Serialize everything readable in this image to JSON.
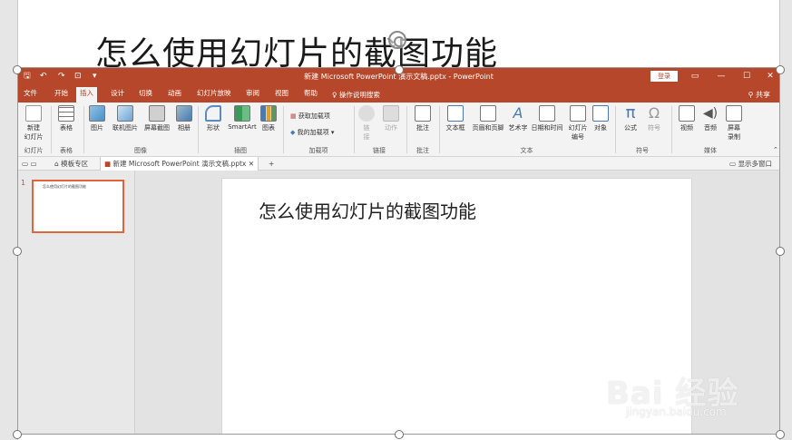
{
  "outer_slide": {
    "title": "怎么使用幻灯片的截图功能"
  },
  "window": {
    "doc_title": "新建 Microsoft PowerPoint 演示文稿.pptx - PowerPoint",
    "login": "登录",
    "quick_access": {
      "save": "🖫",
      "undo": "↶",
      "redo": "↷",
      "more": "▾"
    },
    "win_controls": {
      "ribbon_opts": "▭",
      "minimize": "—",
      "maximize": "☐",
      "close": "✕"
    }
  },
  "tabs": [
    "文件",
    "开始",
    "插入",
    "设计",
    "切换",
    "动画",
    "幻灯片放映",
    "审阅",
    "视图",
    "帮助"
  ],
  "active_tab": "插入",
  "tell_me": "操作说明搜索",
  "share": "共享",
  "ribbon": {
    "groups": {
      "slides": "幻灯片",
      "tables": "表格",
      "images": "图像",
      "illustrations": "插图",
      "addins": "加载项",
      "links": "链接",
      "comments": "批注",
      "text": "文本",
      "symbols": "符号",
      "media": "媒体"
    },
    "buttons": {
      "new_slide_1": "新建",
      "new_slide_2": "幻灯片",
      "table": "表格",
      "picture": "图片",
      "online_picture": "联机图片",
      "screenshot": "屏幕截图",
      "album": "相册",
      "shapes": "形状",
      "smartart": "SmartArt",
      "chart": "图表",
      "get_addins": "获取加载项",
      "my_addins": "我的加载项",
      "link_1": "链",
      "link_2": "接",
      "action": "动作",
      "comment": "批注",
      "textbox": "文本框",
      "header_footer": "页眉和页脚",
      "wordart": "艺术字",
      "datetime": "日期和时间",
      "slide_num_1": "幻灯片",
      "slide_num_2": "编号",
      "object": "对象",
      "equation": "公式",
      "symbol": "符号",
      "video": "视频",
      "audio": "音频",
      "screen_rec_1": "屏幕",
      "screen_rec_2": "录制"
    }
  },
  "doc_tabs": {
    "template": "模板专区",
    "file": "新建 Microsoft PowerPoint 演示文稿.pptx",
    "close": "✕",
    "add": "+",
    "multi_window": "显示多窗口"
  },
  "thumbnail": {
    "number": "1",
    "title": "怎么使用幻灯片的截图功能"
  },
  "slide": {
    "title": "怎么使用幻灯片的截图功能"
  },
  "watermark": {
    "logo": "Bai 经验",
    "url": "jingyan.baidu.com"
  },
  "colors": {
    "accent": "#b7472a",
    "thumb_border": "#e0653b",
    "ribbon_bg": "#f3f3f3"
  }
}
